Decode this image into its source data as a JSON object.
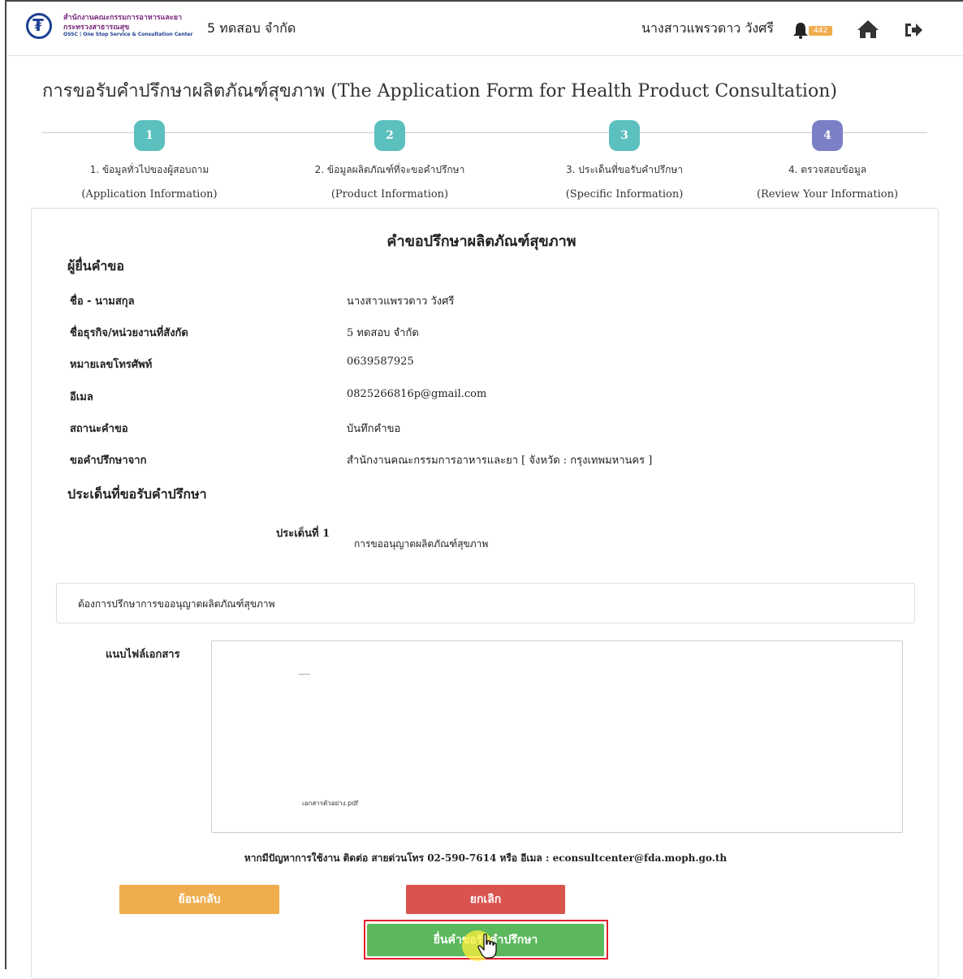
{
  "header": {
    "logo_line1": "สำนักงานคณะกรรมการอาหารและยา",
    "logo_line2": "กระทรวงสาธารณสุข",
    "logo_line3": "OSSC | One Stop Service & Consultation Center",
    "company": "5 ทดสอบ จำกัด",
    "user_name": "นางสาวแพรวดาว วังศรี",
    "notification_count": "442",
    "icons": [
      "bell-icon",
      "home-icon",
      "logout-icon"
    ]
  },
  "page": {
    "title": "การขอรับคำปรึกษาผลิตภัณฑ์สุขภาพ (The Application Form for Health Product Consultation)"
  },
  "steps": [
    {
      "num": "1",
      "th": "1. ข้อมูลทั่วไปของผู้สอบถาม",
      "en": "(Application Information)",
      "color": "#5bc0be"
    },
    {
      "num": "2",
      "th": "2. ข้อมูลผลิตภัณฑ์ที่จะขอคำปรึกษา",
      "en": "(Product Information)",
      "color": "#5bc0be"
    },
    {
      "num": "3",
      "th": "3. ประเด็นที่ขอรับคำปรึกษา",
      "en": "(Specific Information)",
      "color": "#5bc0be"
    },
    {
      "num": "4",
      "th": "4. ตรวจสอบข้อมูล",
      "en": "(Review Your Information)",
      "color": "#7a7fc6"
    }
  ],
  "card": {
    "title": "คำขอปรึกษาผลิตภัณฑ์สุขภาพ",
    "applicant_heading": "ผู้ยื่นคำขอ",
    "rows": [
      {
        "label": "ชื่อ - นามสกุล",
        "value": "นางสาวแพรวดาว วังศรี"
      },
      {
        "label": "ชื่อธุรกิจ/หน่วยงานที่สังกัด",
        "value": "5 ทดสอบ จำกัด"
      },
      {
        "label": "หมายเลขโทรศัพท์",
        "value": "0639587925"
      },
      {
        "label": "อีเมล",
        "value": "0825266816p@gmail.com"
      },
      {
        "label": "สถานะคำขอ",
        "value": "บันทึกคำขอ"
      },
      {
        "label": "ขอคำปรึกษาจาก",
        "value": "สำนักงานคณะกรรมการอาหารและยา [ จังหวัด : กรุงเทพมหานคร ]"
      }
    ],
    "topics_heading": "ประเด็นที่ขอรับคำปรึกษา",
    "topic_label": "ประเด็นที่ 1",
    "topic_value": "การขออนุญาตผลิตภัณฑ์สุขภาพ",
    "detail_text": "ต้องการปรึกษาการขออนุญาตผลิตภัณฑ์สุขภาพ",
    "attach_label": "แนบไฟล์เอกสาร",
    "attach_file": "เอกสารตัวอย่าง.pdf",
    "contact": "หากมีปัญหาการใช้งาน ติดต่อ สายด่วนโทร 02-590-7614 หรือ อีเมล : econsultcenter@fda.moph.go.th"
  },
  "buttons": {
    "back": "ย้อนกลับ",
    "cancel": "ยกเลิก",
    "submit": "ยื่นคำขอรับคำปรึกษา"
  }
}
